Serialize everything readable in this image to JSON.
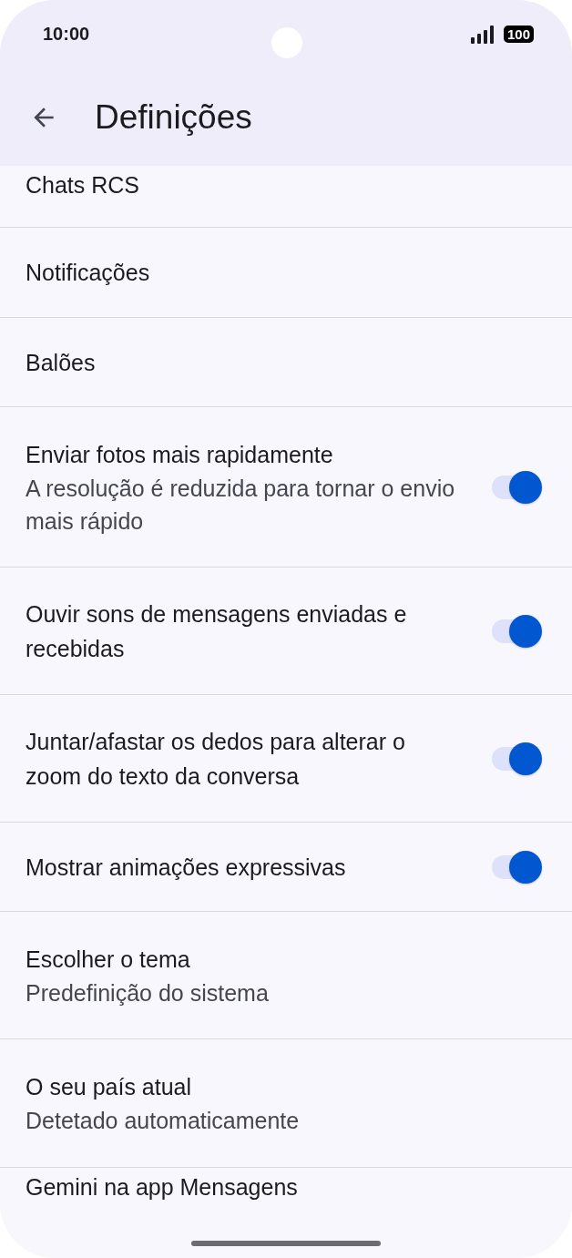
{
  "status_bar": {
    "time": "10:00",
    "battery": "100"
  },
  "header": {
    "title": "Definições"
  },
  "items": [
    {
      "kind": "link",
      "title": "Chats RCS"
    },
    {
      "kind": "link",
      "title": "Notificações"
    },
    {
      "kind": "link",
      "title": "Balões"
    },
    {
      "kind": "toggle",
      "title": "Enviar fotos mais rapidamente",
      "subtitle": "A resolução é reduzida para tornar o envio mais rápido",
      "on": true
    },
    {
      "kind": "toggle",
      "title": "Ouvir sons de mensagens enviadas e recebidas",
      "on": true
    },
    {
      "kind": "toggle",
      "title": "Juntar/afastar os dedos para alterar o zoom do texto da conversa",
      "on": true
    },
    {
      "kind": "toggle",
      "title": "Mostrar animações expressivas",
      "on": true
    },
    {
      "kind": "link",
      "title": "Escolher o tema",
      "subtitle": "Predefinição do sistema"
    },
    {
      "kind": "link",
      "title": "O seu país atual",
      "subtitle": "Detetado automaticamente"
    },
    {
      "kind": "link",
      "title": "Gemini na app Mensagens"
    }
  ]
}
